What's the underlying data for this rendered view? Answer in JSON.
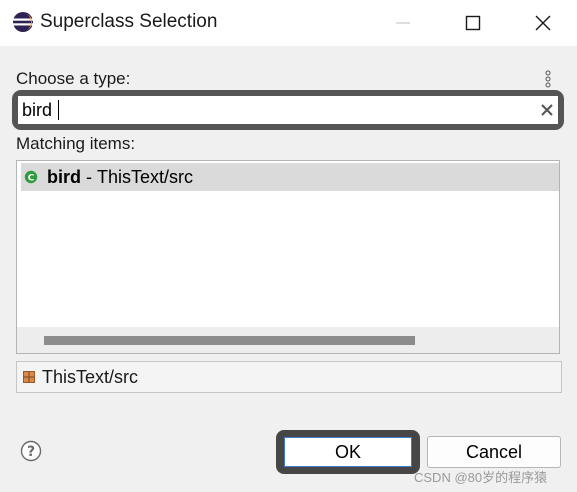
{
  "window": {
    "title": "Superclass Selection"
  },
  "search": {
    "label": "Choose a type:",
    "value": "bird"
  },
  "results": {
    "label": "Matching items:",
    "items": [
      {
        "name": "bird",
        "separator": " - ",
        "location": "ThisText/src",
        "selected": true,
        "icon": "class-icon"
      }
    ],
    "scroll_fraction": 0.76
  },
  "details": {
    "location": "ThisText/src",
    "icon": "package-icon"
  },
  "buttons": {
    "ok_label": "OK",
    "cancel_label": "Cancel"
  },
  "watermark": "CSDN @80岁的程序猿",
  "colors": {
    "accent": "#3a7bd5",
    "selection": "#dadada",
    "highlight_frame": "#464646",
    "class_icon": "#2e9b3f"
  }
}
